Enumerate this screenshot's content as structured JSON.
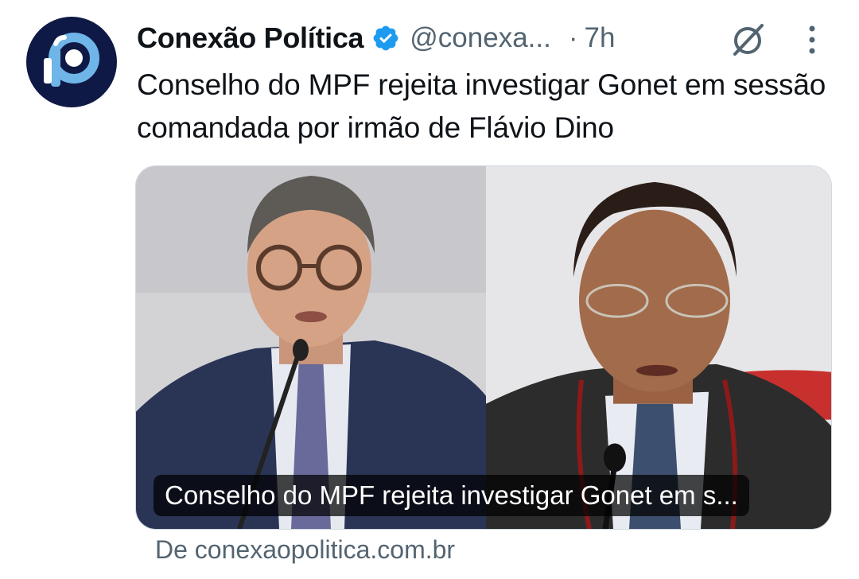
{
  "tweet": {
    "display_name": "Conexão Política",
    "handle": "@conexa...",
    "separator": "·",
    "time": "7h",
    "verified_icon": "verified-badge-icon",
    "text": "Conselho do MPF rejeita investigar Gonet em sessão comandada por irmão de Flávio Dino"
  },
  "card": {
    "title": "Conselho do MPF rejeita investigar Gonet em s...",
    "source": "De conexaopolitica.com.br"
  },
  "icons": {
    "grok": "grok-icon",
    "more": "more-options-icon",
    "avatar": "avatar-logo"
  },
  "colors": {
    "verified": "#1d9bf0",
    "secondary_text": "#536471",
    "avatar_bg": "#0e1a45"
  }
}
